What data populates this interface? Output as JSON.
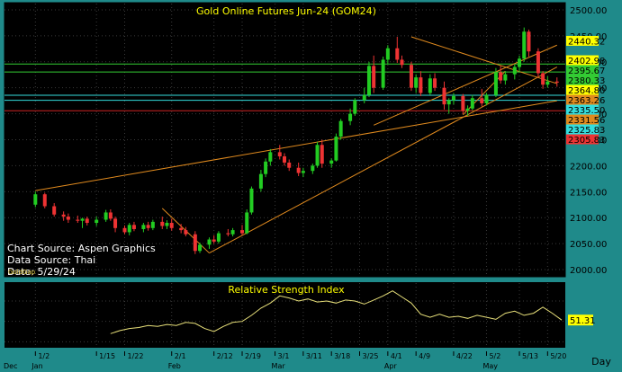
{
  "colors": {
    "frame": "#1f8a8a",
    "panel_bg": "#000000",
    "grid": "#3a3a3a",
    "title": "#ffff00",
    "candle_up": "#22cc22",
    "candle_down": "#ee3333",
    "trend": "#e08a1e",
    "green_line": "#33cc33",
    "cyan_line": "#33dddd",
    "red_line": "#cc2222",
    "rsi": "#e8e07a"
  },
  "chart_data": [
    {
      "type": "candlestick",
      "title": "Gold  Online  Futures  Jun-24  (GOM24)",
      "yticks": [
        2000,
        2050,
        2100,
        2150,
        2200,
        2250,
        2300,
        2350,
        2400,
        2450,
        2500
      ],
      "ytick_labels": [
        "2000.00",
        "2050.00",
        "2100.00",
        "2150.00",
        "2200.00",
        "2250.00",
        "2300.00",
        "2350.00",
        "2400.00",
        "2450.00",
        "2500.00"
      ],
      "ylim": [
        1988,
        2512
      ],
      "xlim": [
        0,
        118
      ],
      "notes": [
        "Chart Source: Aspen Graphics",
        "Data Source: Thai",
        "Date: 5/29/24"
      ],
      "watermark": "GoldGap",
      "price_levels": [
        {
          "label": "2440.32",
          "value": 2440.32,
          "color": "#ffff00",
          "line": null
        },
        {
          "label": "2402.98",
          "value": 2402.98,
          "color": "#ffff00",
          "line": null
        },
        {
          "label": "2395.67",
          "value": 2395.67,
          "color": "#33cc33",
          "line": "#33cc33"
        },
        {
          "label": "2380.33",
          "value": 2380.33,
          "color": "#33cc33",
          "line": "#33cc33"
        },
        {
          "label": "2364.80",
          "value": 2364.8,
          "color": "#ffff00",
          "line": null
        },
        {
          "label": "2363.26",
          "value": 2363.26,
          "color": "#e08a1e",
          "line": null
        },
        {
          "label": "2335.50",
          "value": 2335.5,
          "color": "#33dddd",
          "line": "#33dddd"
        },
        {
          "label": "2331.56",
          "value": 2331.56,
          "color": "#e08a1e",
          "line": null
        },
        {
          "label": "2325.83",
          "value": 2325.83,
          "color": "#33dddd",
          "line": "#33dddd"
        },
        {
          "label": "2305.83",
          "value": 2305.83,
          "color": "#ee3333",
          "line": "#cc2222"
        }
      ],
      "trendlines": [
        {
          "x1": 6,
          "y1": 2152,
          "x2": 117,
          "y2": 2325
        },
        {
          "x1": 33,
          "y1": 2118,
          "x2": 43,
          "y2": 2032
        },
        {
          "x1": 43,
          "y1": 2032,
          "x2": 117,
          "y2": 2390
        },
        {
          "x1": 78,
          "y1": 2278,
          "x2": 117,
          "y2": 2432
        },
        {
          "x1": 86,
          "y1": 2448,
          "x2": 117,
          "y2": 2358
        },
        {
          "x1": 97,
          "y1": 2298,
          "x2": 106,
          "y2": 2382
        }
      ],
      "candles": [
        {
          "x": 6,
          "o": 2125,
          "h": 2150,
          "l": 2120,
          "c": 2145
        },
        {
          "x": 8,
          "o": 2145,
          "h": 2148,
          "l": 2118,
          "c": 2122
        },
        {
          "x": 10,
          "o": 2122,
          "h": 2128,
          "l": 2102,
          "c": 2106
        },
        {
          "x": 12,
          "o": 2106,
          "h": 2112,
          "l": 2094,
          "c": 2102
        },
        {
          "x": 13,
          "o": 2102,
          "h": 2108,
          "l": 2090,
          "c": 2096
        },
        {
          "x": 15,
          "o": 2096,
          "h": 2104,
          "l": 2090,
          "c": 2094
        },
        {
          "x": 16,
          "o": 2094,
          "h": 2100,
          "l": 2080,
          "c": 2098
        },
        {
          "x": 17,
          "o": 2098,
          "h": 2102,
          "l": 2085,
          "c": 2090
        },
        {
          "x": 19,
          "o": 2090,
          "h": 2102,
          "l": 2084,
          "c": 2096
        },
        {
          "x": 21,
          "o": 2096,
          "h": 2115,
          "l": 2092,
          "c": 2110
        },
        {
          "x": 22,
          "o": 2110,
          "h": 2116,
          "l": 2094,
          "c": 2098
        },
        {
          "x": 23,
          "o": 2098,
          "h": 2102,
          "l": 2072,
          "c": 2080
        },
        {
          "x": 25,
          "o": 2080,
          "h": 2085,
          "l": 2068,
          "c": 2072
        },
        {
          "x": 26,
          "o": 2072,
          "h": 2090,
          "l": 2066,
          "c": 2086
        },
        {
          "x": 27,
          "o": 2086,
          "h": 2092,
          "l": 2074,
          "c": 2078
        },
        {
          "x": 29,
          "o": 2078,
          "h": 2090,
          "l": 2072,
          "c": 2086
        },
        {
          "x": 30,
          "o": 2086,
          "h": 2092,
          "l": 2075,
          "c": 2080
        },
        {
          "x": 31,
          "o": 2080,
          "h": 2096,
          "l": 2076,
          "c": 2092
        },
        {
          "x": 33,
          "o": 2092,
          "h": 2102,
          "l": 2078,
          "c": 2084
        },
        {
          "x": 34,
          "o": 2084,
          "h": 2095,
          "l": 2078,
          "c": 2090
        },
        {
          "x": 35,
          "o": 2090,
          "h": 2098,
          "l": 2075,
          "c": 2080
        },
        {
          "x": 37,
          "o": 2080,
          "h": 2088,
          "l": 2070,
          "c": 2076
        },
        {
          "x": 38,
          "o": 2076,
          "h": 2082,
          "l": 2064,
          "c": 2068
        },
        {
          "x": 40,
          "o": 2068,
          "h": 2074,
          "l": 2030,
          "c": 2036
        },
        {
          "x": 41,
          "o": 2036,
          "h": 2052,
          "l": 2032,
          "c": 2048
        },
        {
          "x": 43,
          "o": 2048,
          "h": 2062,
          "l": 2040,
          "c": 2058
        },
        {
          "x": 44,
          "o": 2058,
          "h": 2066,
          "l": 2050,
          "c": 2054
        },
        {
          "x": 45,
          "o": 2054,
          "h": 2074,
          "l": 2050,
          "c": 2070
        },
        {
          "x": 47,
          "o": 2070,
          "h": 2078,
          "l": 2064,
          "c": 2068
        },
        {
          "x": 48,
          "o": 2068,
          "h": 2080,
          "l": 2064,
          "c": 2076
        },
        {
          "x": 50,
          "o": 2076,
          "h": 2086,
          "l": 2066,
          "c": 2070
        },
        {
          "x": 51,
          "o": 2070,
          "h": 2116,
          "l": 2068,
          "c": 2110
        },
        {
          "x": 52,
          "o": 2110,
          "h": 2160,
          "l": 2106,
          "c": 2156
        },
        {
          "x": 54,
          "o": 2156,
          "h": 2192,
          "l": 2150,
          "c": 2184
        },
        {
          "x": 55,
          "o": 2184,
          "h": 2214,
          "l": 2178,
          "c": 2208
        },
        {
          "x": 56,
          "o": 2208,
          "h": 2232,
          "l": 2200,
          "c": 2226
        },
        {
          "x": 58,
          "o": 2226,
          "h": 2240,
          "l": 2212,
          "c": 2218
        },
        {
          "x": 59,
          "o": 2218,
          "h": 2224,
          "l": 2200,
          "c": 2206
        },
        {
          "x": 60,
          "o": 2206,
          "h": 2212,
          "l": 2190,
          "c": 2196
        },
        {
          "x": 62,
          "o": 2196,
          "h": 2206,
          "l": 2180,
          "c": 2186
        },
        {
          "x": 63,
          "o": 2186,
          "h": 2196,
          "l": 2178,
          "c": 2190
        },
        {
          "x": 65,
          "o": 2190,
          "h": 2204,
          "l": 2184,
          "c": 2200
        },
        {
          "x": 66,
          "o": 2200,
          "h": 2246,
          "l": 2196,
          "c": 2240
        },
        {
          "x": 67,
          "o": 2240,
          "h": 2250,
          "l": 2196,
          "c": 2204
        },
        {
          "x": 69,
          "o": 2204,
          "h": 2214,
          "l": 2196,
          "c": 2210
        },
        {
          "x": 70,
          "o": 2210,
          "h": 2262,
          "l": 2208,
          "c": 2256
        },
        {
          "x": 71,
          "o": 2256,
          "h": 2290,
          "l": 2250,
          "c": 2286
        },
        {
          "x": 73,
          "o": 2286,
          "h": 2310,
          "l": 2278,
          "c": 2300
        },
        {
          "x": 74,
          "o": 2300,
          "h": 2330,
          "l": 2296,
          "c": 2326
        },
        {
          "x": 76,
          "o": 2326,
          "h": 2350,
          "l": 2320,
          "c": 2336
        },
        {
          "x": 77,
          "o": 2336,
          "h": 2400,
          "l": 2332,
          "c": 2392
        },
        {
          "x": 78,
          "o": 2392,
          "h": 2412,
          "l": 2340,
          "c": 2350
        },
        {
          "x": 80,
          "o": 2350,
          "h": 2410,
          "l": 2346,
          "c": 2404
        },
        {
          "x": 81,
          "o": 2404,
          "h": 2432,
          "l": 2396,
          "c": 2426
        },
        {
          "x": 83,
          "o": 2426,
          "h": 2448,
          "l": 2398,
          "c": 2404
        },
        {
          "x": 84,
          "o": 2404,
          "h": 2412,
          "l": 2388,
          "c": 2394
        },
        {
          "x": 86,
          "o": 2394,
          "h": 2400,
          "l": 2344,
          "c": 2350
        },
        {
          "x": 87,
          "o": 2350,
          "h": 2376,
          "l": 2340,
          "c": 2370
        },
        {
          "x": 88,
          "o": 2370,
          "h": 2382,
          "l": 2334,
          "c": 2340
        },
        {
          "x": 90,
          "o": 2340,
          "h": 2376,
          "l": 2336,
          "c": 2368
        },
        {
          "x": 91,
          "o": 2368,
          "h": 2378,
          "l": 2344,
          "c": 2350
        },
        {
          "x": 93,
          "o": 2350,
          "h": 2362,
          "l": 2308,
          "c": 2318
        },
        {
          "x": 94,
          "o": 2318,
          "h": 2330,
          "l": 2300,
          "c": 2326
        },
        {
          "x": 95,
          "o": 2326,
          "h": 2340,
          "l": 2318,
          "c": 2334
        },
        {
          "x": 97,
          "o": 2334,
          "h": 2338,
          "l": 2300,
          "c": 2306
        },
        {
          "x": 98,
          "o": 2306,
          "h": 2316,
          "l": 2296,
          "c": 2310
        },
        {
          "x": 99,
          "o": 2310,
          "h": 2336,
          "l": 2306,
          "c": 2330
        },
        {
          "x": 101,
          "o": 2330,
          "h": 2348,
          "l": 2314,
          "c": 2320
        },
        {
          "x": 102,
          "o": 2320,
          "h": 2340,
          "l": 2316,
          "c": 2336
        },
        {
          "x": 104,
          "o": 2336,
          "h": 2388,
          "l": 2332,
          "c": 2380
        },
        {
          "x": 105,
          "o": 2380,
          "h": 2392,
          "l": 2358,
          "c": 2364
        },
        {
          "x": 106,
          "o": 2364,
          "h": 2382,
          "l": 2356,
          "c": 2376
        },
        {
          "x": 108,
          "o": 2376,
          "h": 2396,
          "l": 2366,
          "c": 2390
        },
        {
          "x": 109,
          "o": 2390,
          "h": 2412,
          "l": 2380,
          "c": 2406
        },
        {
          "x": 110,
          "o": 2406,
          "h": 2466,
          "l": 2400,
          "c": 2458
        },
        {
          "x": 111,
          "o": 2458,
          "h": 2462,
          "l": 2410,
          "c": 2420
        },
        {
          "x": 113,
          "o": 2420,
          "h": 2426,
          "l": 2370,
          "c": 2378
        },
        {
          "x": 114,
          "o": 2378,
          "h": 2382,
          "l": 2348,
          "c": 2356
        },
        {
          "x": 115,
          "o": 2356,
          "h": 2372,
          "l": 2350,
          "c": 2362
        },
        {
          "x": 117,
          "o": 2362,
          "h": 2370,
          "l": 2352,
          "c": 2360
        }
      ]
    },
    {
      "type": "line",
      "title": "Relative Strength Index",
      "ylim": [
        25,
        85
      ],
      "xlim": [
        0,
        118
      ],
      "last_value_label": "51.31",
      "last_value": 51.31,
      "x_tick_labels": [
        "1/2",
        "1/15",
        "1/22",
        "2/1",
        "2/12",
        "2/19",
        "3/1",
        "3/11",
        "3/18",
        "3/25",
        "4/1",
        "4/9",
        "4/22",
        "5/2",
        "5/13",
        "5/20"
      ],
      "x_ticks": [
        6,
        19,
        25,
        35,
        44,
        50,
        57,
        63,
        69,
        75,
        81,
        87,
        95,
        102,
        109,
        115
      ],
      "month_labels": [
        "Dec",
        "Jan",
        "Feb",
        "Mar",
        "Apr",
        "May"
      ],
      "month_positions": [
        0,
        6,
        35,
        57,
        81,
        102
      ],
      "x_axis_label": "Day",
      "x": [
        22,
        24,
        26,
        28,
        30,
        32,
        34,
        36,
        38,
        40,
        42,
        44,
        46,
        48,
        50,
        52,
        54,
        56,
        58,
        60,
        62,
        64,
        66,
        68,
        70,
        72,
        74,
        76,
        78,
        80,
        82,
        84,
        86,
        88,
        90,
        92,
        94,
        96,
        98,
        100,
        102,
        104,
        106,
        108,
        110,
        112,
        114,
        116,
        118
      ],
      "values": [
        38,
        41,
        43,
        44,
        46,
        45,
        47,
        46,
        49,
        48,
        43,
        40,
        45,
        49,
        50,
        56,
        63,
        68,
        75,
        73,
        70,
        72,
        69,
        70,
        68,
        71,
        70,
        67,
        71,
        75,
        80,
        74,
        68,
        57,
        54,
        57,
        54,
        55,
        53,
        56,
        54,
        52,
        58,
        60,
        56,
        58,
        64,
        58,
        51.31
      ]
    }
  ]
}
